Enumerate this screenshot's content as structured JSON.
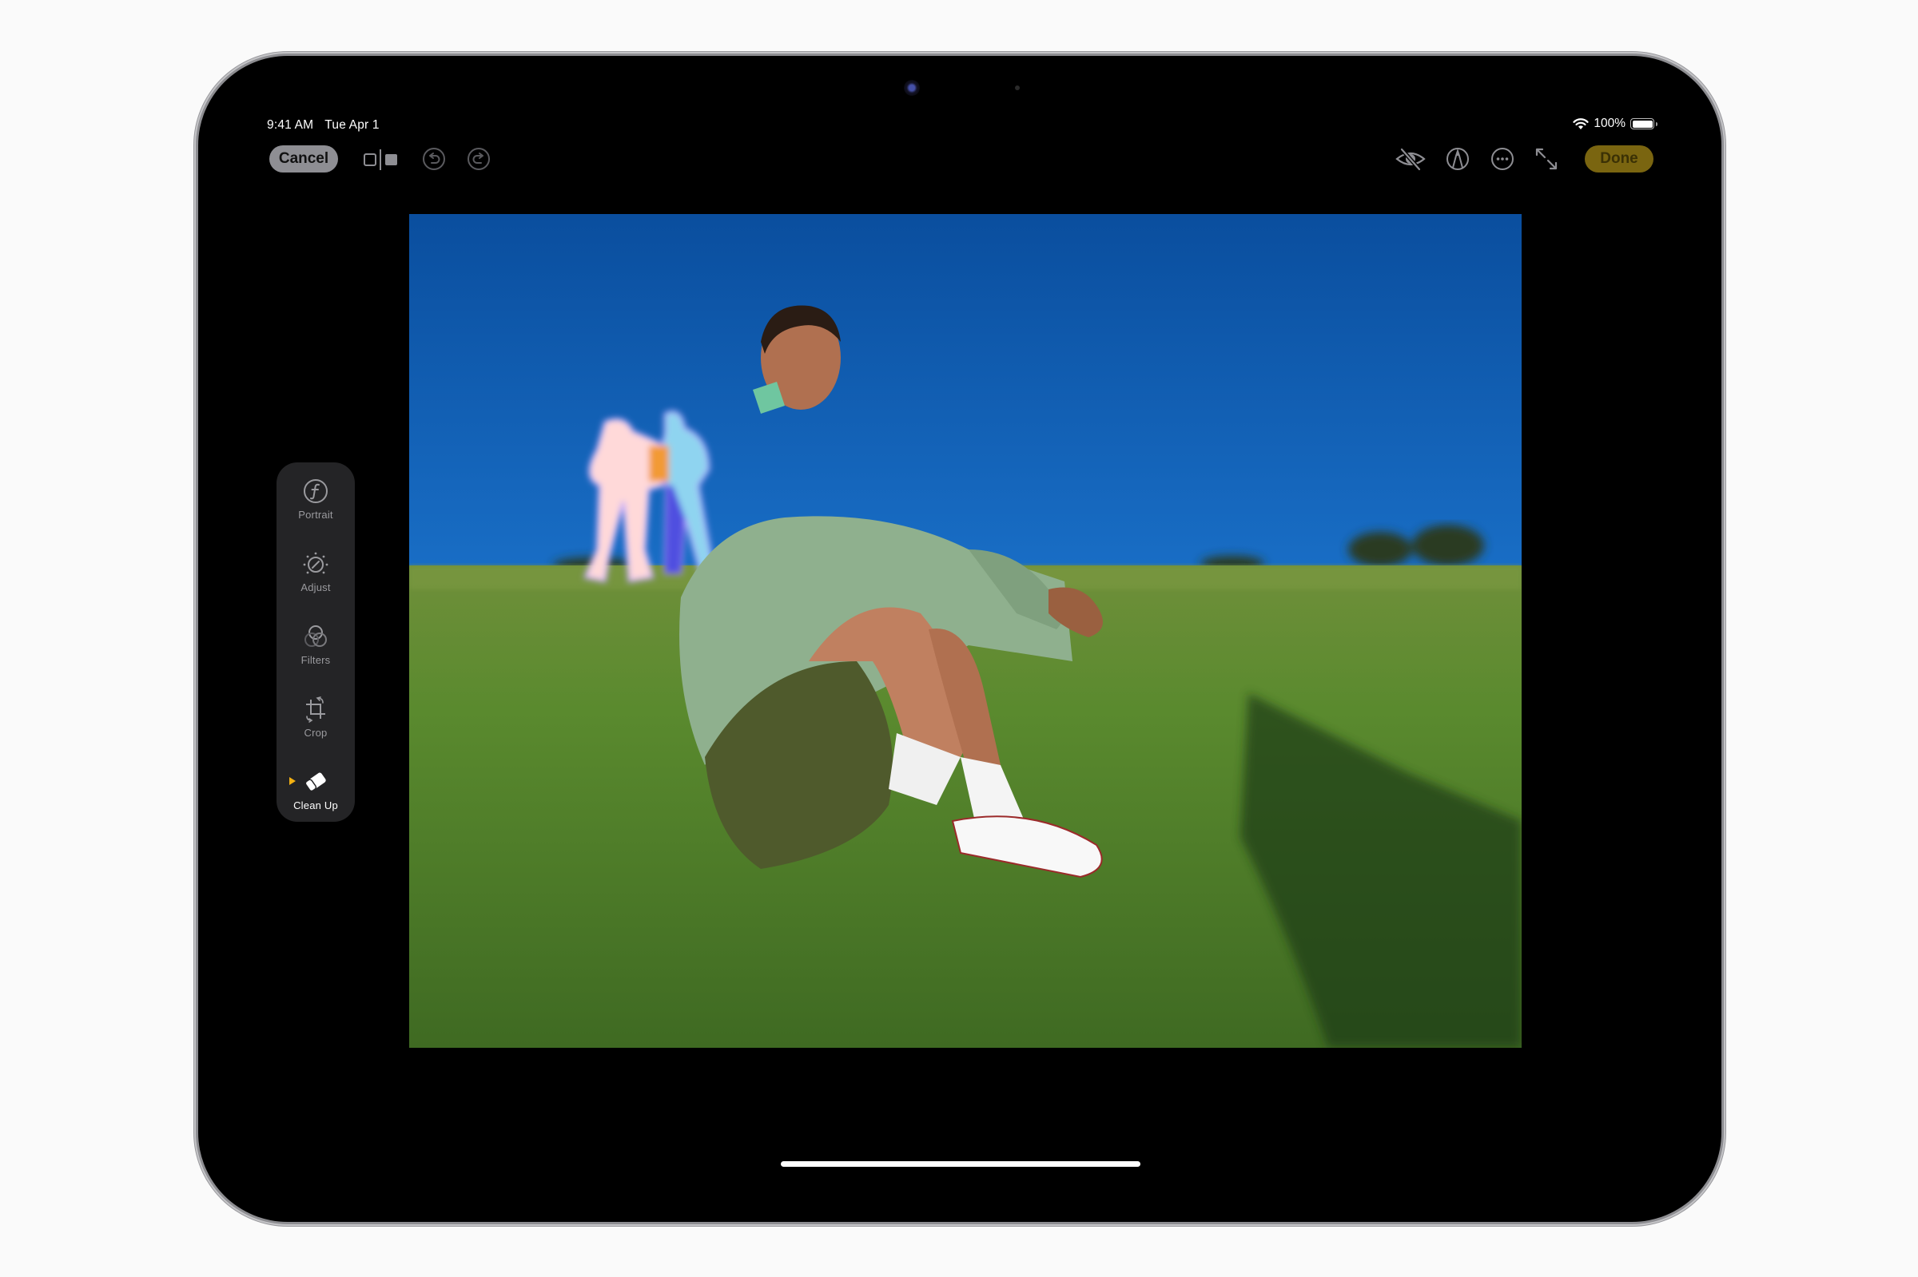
{
  "status_bar": {
    "time": "9:41 AM",
    "date": "Tue Apr 1",
    "battery_percent": "100%",
    "battery_level": 1.0,
    "wifi_icon": "wifi-icon",
    "battery_icon": "battery-icon"
  },
  "toolbar": {
    "cancel_label": "Cancel",
    "done_label": "Done",
    "left_icons": [
      "compare-icon",
      "undo-icon",
      "redo-icon"
    ],
    "right_icons": [
      "hide-eye-slash-icon",
      "markup-pen-icon",
      "more-ellipsis-icon",
      "expand-arrows-icon"
    ],
    "done_color": "#7a6510"
  },
  "tools": {
    "items": [
      {
        "label": "Portrait",
        "icon": "portrait-f-icon",
        "active": false
      },
      {
        "label": "Adjust",
        "icon": "adjust-dial-icon",
        "active": false
      },
      {
        "label": "Filters",
        "icon": "filters-circles-icon",
        "active": false
      },
      {
        "label": "Crop",
        "icon": "crop-rotate-icon",
        "active": false
      },
      {
        "label": "Clean Up",
        "icon": "eraser-icon",
        "active": true
      }
    ],
    "active_marker_color": "#f2b012"
  },
  "photo": {
    "description": "Woman in green sweatshirt sitting on grass under blue sky; two background people highlighted by Clean Up",
    "sky_top": "#0a56b0",
    "sky_bottom": "#5aa8e8",
    "grass": "#4f7a2a"
  }
}
